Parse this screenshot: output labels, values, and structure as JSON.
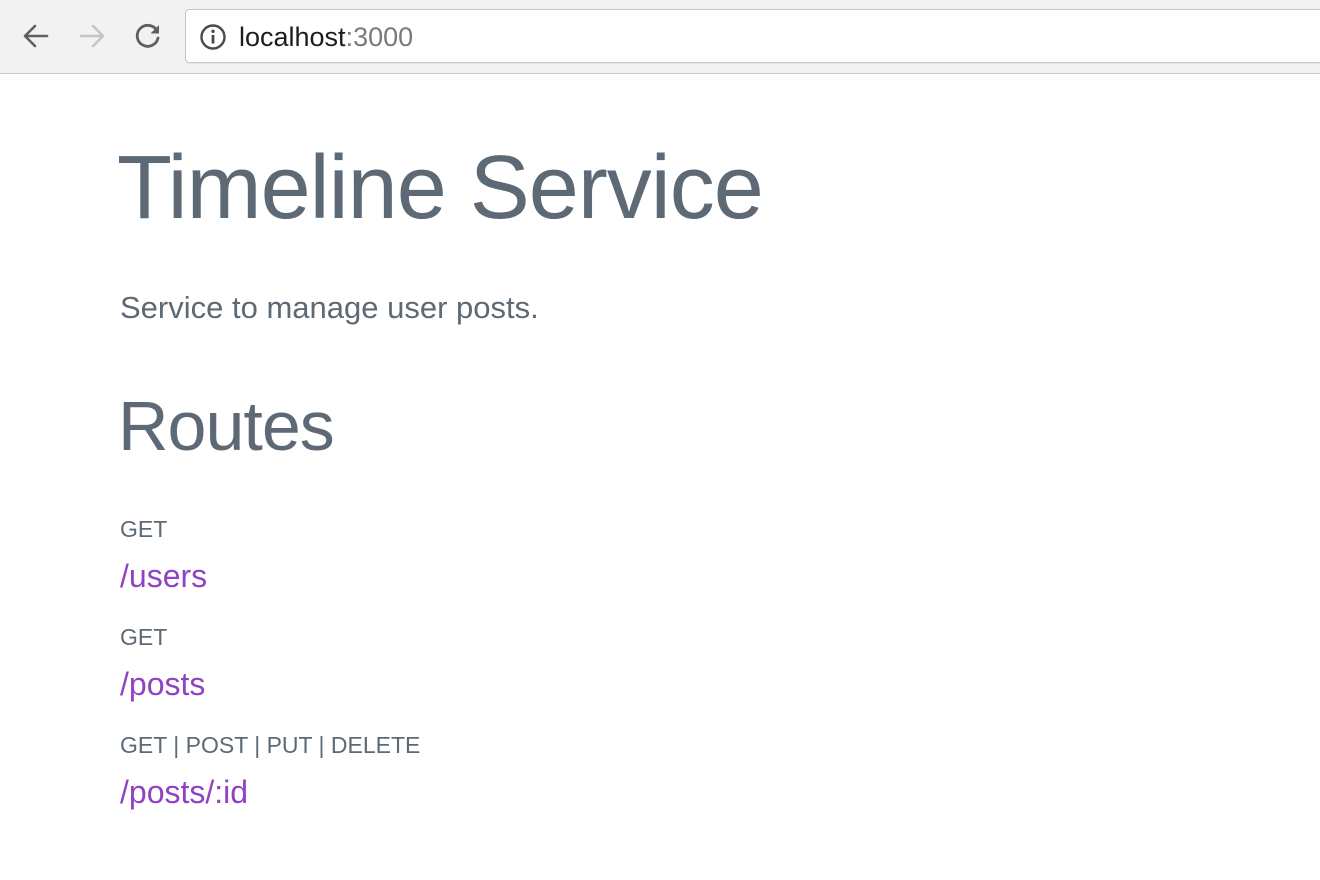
{
  "browser": {
    "url_host": "localhost",
    "url_port": ":3000",
    "icons": {
      "back": "arrow-left-icon",
      "forward": "arrow-right-icon",
      "reload": "reload-icon",
      "site_info": "info-icon"
    }
  },
  "page": {
    "title": "Timeline Service",
    "description": "Service to manage user posts.",
    "routes_heading": "Routes",
    "routes": [
      {
        "methods": "GET",
        "path": "/users"
      },
      {
        "methods": "GET",
        "path": "/posts"
      },
      {
        "methods": "GET | POST | PUT | DELETE",
        "path": "/posts/:id"
      }
    ]
  },
  "colors": {
    "text": "#5d6a75",
    "link": "#9042c4",
    "toolbar_bg": "#f2f2f2"
  }
}
